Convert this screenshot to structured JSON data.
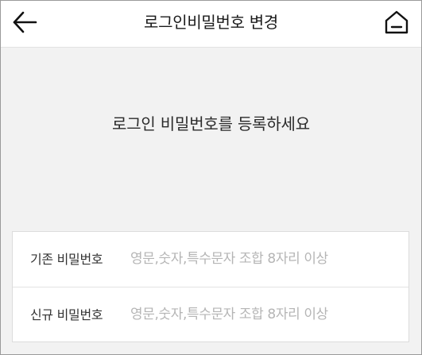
{
  "header": {
    "title": "로그인비밀번호 변경",
    "back_icon": "arrow-left-icon",
    "home_icon": "home-icon"
  },
  "main": {
    "message": "로그인 비밀번호를 등록하세요"
  },
  "form": {
    "current_password": {
      "label": "기존 비밀번호",
      "placeholder": "영문,숫자,특수문자 조합 8자리 이상",
      "value": ""
    },
    "new_password": {
      "label": "신규 비밀번호",
      "placeholder": "영문,숫자,특수문자 조합 8자리 이상",
      "value": ""
    }
  },
  "colors": {
    "header_bg": "#ffffff",
    "page_bg": "#f2f2f2",
    "placeholder": "#b5b5b5",
    "text": "#222222"
  }
}
